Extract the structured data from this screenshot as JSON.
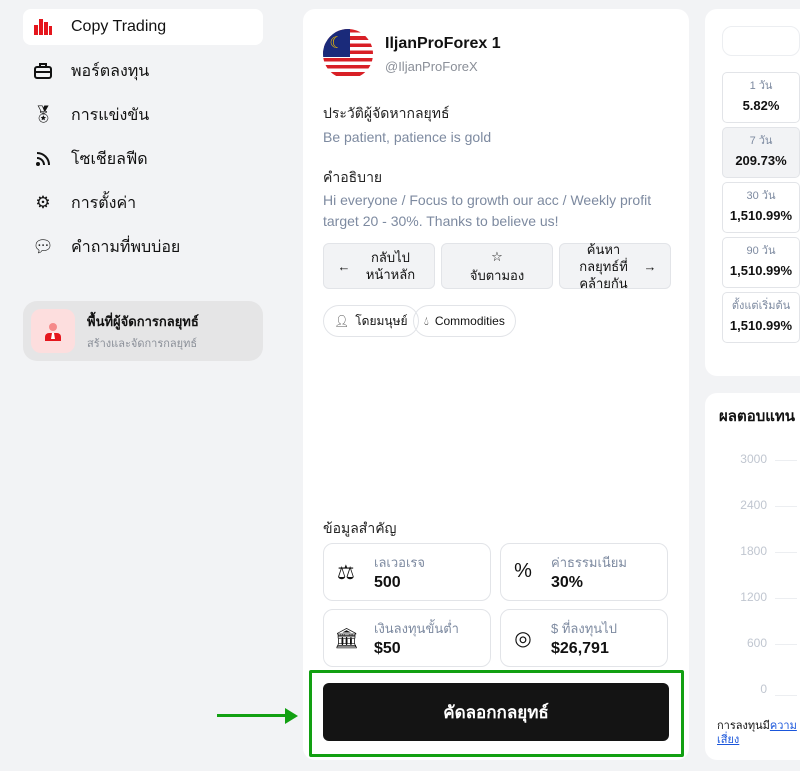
{
  "sidebar": {
    "items": [
      {
        "label": "Copy Trading",
        "icon": "bar-chart-icon"
      },
      {
        "label": "พอร์ตลงทุน",
        "icon": "briefcase-icon"
      },
      {
        "label": "การแข่งขัน",
        "icon": "award-icon"
      },
      {
        "label": "โซเชียลฟีด",
        "icon": "rss-icon"
      },
      {
        "label": "การตั้งค่า",
        "icon": "gear-icon"
      },
      {
        "label": "คำถามที่พบบ่อย",
        "icon": "chat-question-icon"
      }
    ],
    "manager": {
      "title": "พื้นที่ผู้จัดการกลยุทธ์",
      "subtitle": "สร้างและจัดการกลยุทธ์"
    }
  },
  "strategy": {
    "name": "IljanProForex 1",
    "handle": "@IljanProForeX",
    "history_label": "ประวัติผู้จัดหากลยุทธ์",
    "history": "Be patient, patience is gold",
    "desc_label": "คำอธิบาย",
    "desc": "Hi everyone / Focus to growth our acc / Weekly profit target 20 - 30%. Thanks to believe us!",
    "buttons": {
      "back": "กลับไป หน้าหลัก",
      "watch": "จับตามอง",
      "similar": "ค้นหา กลยุทธ์ที่ คล้ายกัน"
    },
    "tags": [
      "โดยมนุษย์",
      "Commodities"
    ],
    "key_label": "ข้อมูลสำคัญ",
    "stats": [
      {
        "label": "เลเวอเรจ",
        "value": "500"
      },
      {
        "label": "ค่าธรรมเนียม",
        "value": "30%"
      },
      {
        "label": "เงินลงทุนขั้นต่ำ",
        "value": "$50"
      },
      {
        "label": "$ ที่ลงทุนไป",
        "value": "$26,791"
      }
    ],
    "copy_button": "คัดลอกกลยุทธ์"
  },
  "periods": [
    {
      "label": "1 วัน",
      "value": "5.82%"
    },
    {
      "label": "7 วัน",
      "value": "209.73%"
    },
    {
      "label": "30 วัน",
      "value": "1,510.99%"
    },
    {
      "label": "90 วัน",
      "value": "1,510.99%"
    },
    {
      "label": "ตั้งแต่เริ่มต้น",
      "value": "1,510.99%"
    }
  ],
  "returns": {
    "title": "ผลตอบแทน",
    "y_ticks": [
      "3000",
      "2400",
      "1800",
      "1200",
      "600",
      "0"
    ],
    "risk_text": "การลงทุนมี",
    "risk_link": "ความเสี่ยง"
  },
  "colors": {
    "accent": "#e5161d",
    "highlight": "#12a012"
  }
}
